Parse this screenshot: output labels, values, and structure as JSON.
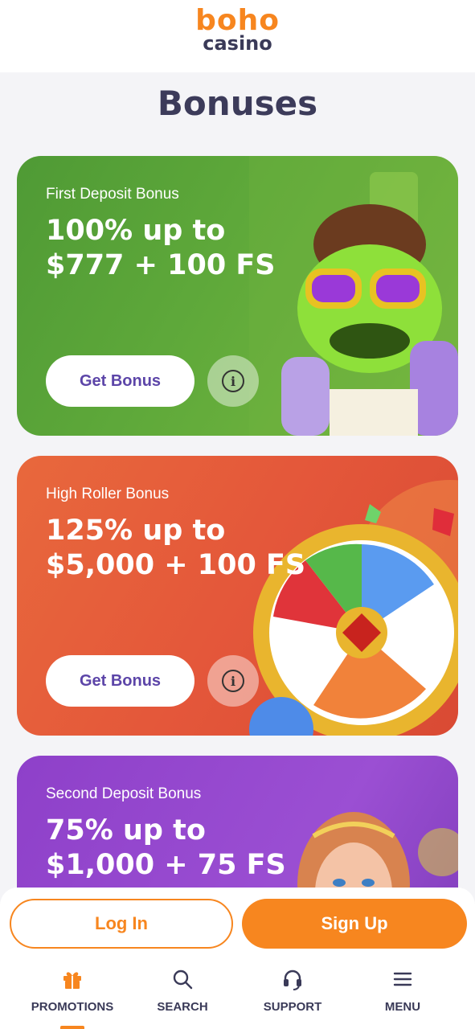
{
  "brand": {
    "logo_top": "boho",
    "logo_bottom": "casino",
    "accent": "#f7861f",
    "dark": "#3a3a58"
  },
  "page": {
    "title": "Bonuses"
  },
  "bonuses": [
    {
      "label": "First Deposit Bonus",
      "title": "100% up to $777 + 100 FS",
      "button": "Get Bonus",
      "info_icon": "info-icon",
      "color": "#5fa93a"
    },
    {
      "label": "High Roller Bonus",
      "title": "125% up to $5,000 + 100 FS",
      "button": "Get Bonus",
      "info_icon": "info-icon",
      "color": "#e4573a"
    },
    {
      "label": "Second Deposit Bonus",
      "title": "75% up to $1,000 + 75 FS",
      "color": "#9b4fd3"
    }
  ],
  "auth": {
    "login": "Log In",
    "signup": "Sign Up"
  },
  "nav": [
    {
      "label": "PROMOTIONS",
      "icon": "gift-icon",
      "active": true
    },
    {
      "label": "SEARCH",
      "icon": "search-icon",
      "active": false
    },
    {
      "label": "SUPPORT",
      "icon": "headset-icon",
      "active": false
    },
    {
      "label": "MENU",
      "icon": "menu-icon",
      "active": false
    }
  ]
}
